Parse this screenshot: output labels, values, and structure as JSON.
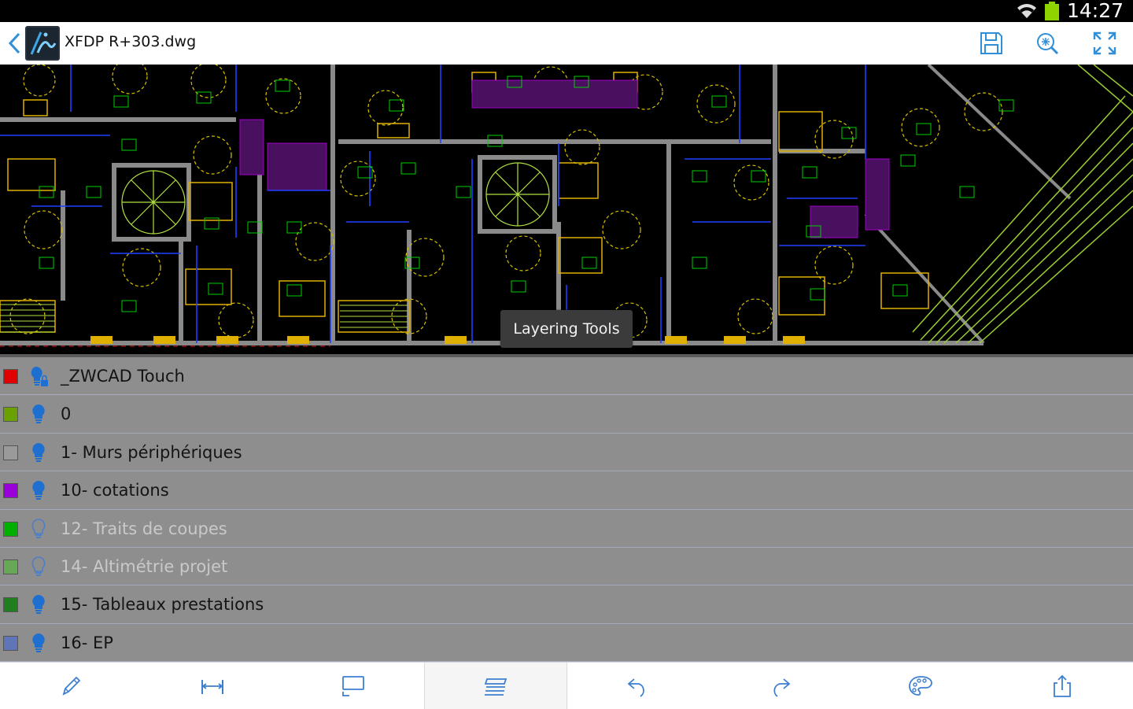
{
  "status": {
    "time": "14:27"
  },
  "appbar": {
    "filename": "XFDP R+303.dwg"
  },
  "tooltip": {
    "text": "Layering Tools"
  },
  "layers": [
    {
      "name": "_ZWCAD Touch",
      "color": "#e00000",
      "visible": true,
      "locked": true
    },
    {
      "name": "0",
      "color": "#6aa000",
      "visible": true,
      "locked": false
    },
    {
      "name": "1- Murs périphériques",
      "color": "#9a9a9a",
      "visible": true,
      "locked": false
    },
    {
      "name": "10- cotations",
      "color": "#9a00d8",
      "visible": true,
      "locked": false
    },
    {
      "name": "12- Traits de coupes",
      "color": "#00b000",
      "visible": false,
      "locked": false
    },
    {
      "name": "14- Altimétrie projet",
      "color": "#66a855",
      "visible": false,
      "locked": false
    },
    {
      "name": "15- Tableaux prestations",
      "color": "#1f7f1f",
      "visible": true,
      "locked": false
    },
    {
      "name": "16- EP",
      "color": "#5f75b8",
      "visible": true,
      "locked": false
    }
  ],
  "toolbar": [
    "pencil-icon",
    "measure-icon",
    "screen-icon",
    "layers-icon",
    "undo-icon",
    "redo-icon",
    "palette-icon",
    "share-icon"
  ]
}
